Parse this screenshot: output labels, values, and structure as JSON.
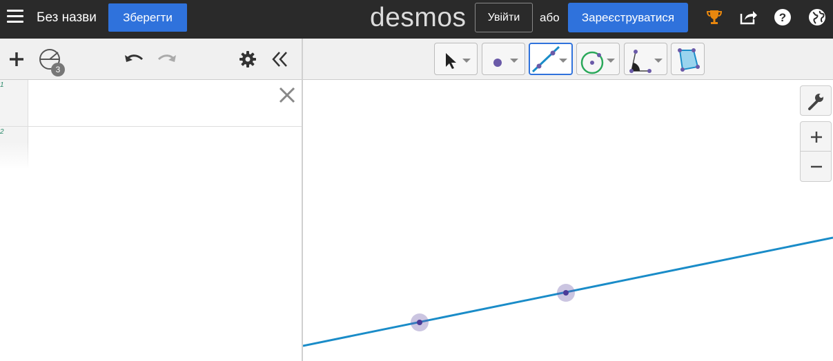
{
  "topbar": {
    "doc_title": "Без назви",
    "save_label": "Зберегти",
    "logo": "desmos",
    "login_label": "Увійти",
    "or_text": "або",
    "signup_label": "Зареєструватися",
    "icons": [
      "menu-icon",
      "trophy-icon",
      "share-icon",
      "help-icon",
      "globe-icon"
    ]
  },
  "expression_toolbar": {
    "folder_badge": "3",
    "icons": [
      "plus-icon",
      "compass-icon",
      "undo-icon",
      "redo-icon",
      "gear-icon",
      "collapse-icon"
    ]
  },
  "expressions": [
    {
      "number": "1",
      "value": ""
    },
    {
      "number": "2",
      "value": ""
    }
  ],
  "tools": [
    {
      "name": "select",
      "icon": "cursor-icon"
    },
    {
      "name": "point",
      "icon": "point-icon"
    },
    {
      "name": "line",
      "icon": "line-icon",
      "active": true
    },
    {
      "name": "circle",
      "icon": "circle-icon"
    },
    {
      "name": "angle",
      "icon": "angle-icon"
    },
    {
      "name": "polygon",
      "icon": "polygon-icon"
    }
  ],
  "graph_controls": [
    "wrench-icon",
    "zoom-in-icon",
    "zoom-out-icon"
  ],
  "colors": {
    "topbar_bg": "#2a2a2a",
    "accent_blue": "#2f72dc",
    "line_blue": "#1a8cc8",
    "point_purple": "#6a5aa8",
    "trophy_orange": "#e8870e",
    "circle_green": "#2aa85a"
  }
}
